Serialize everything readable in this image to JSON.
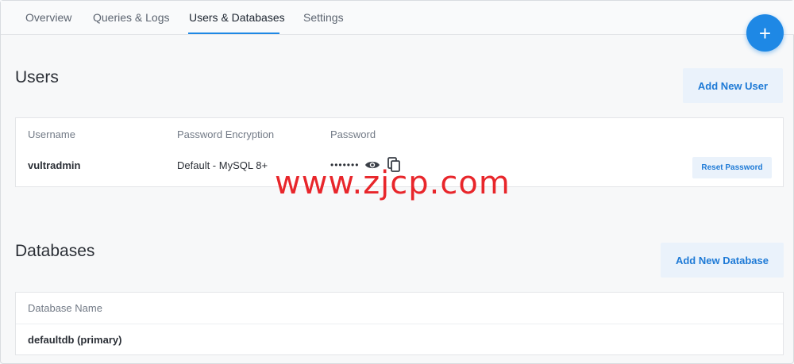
{
  "tabs": [
    {
      "label": "Overview"
    },
    {
      "label": "Queries & Logs"
    },
    {
      "label": "Users & Databases"
    },
    {
      "label": "Settings"
    }
  ],
  "active_tab": "Users & Databases",
  "fab": {
    "label": "+",
    "icon": "plus-icon"
  },
  "users": {
    "title": "Users",
    "add_button": "Add New User",
    "columns": [
      "Username",
      "Password Encryption",
      "Password"
    ],
    "rows": [
      {
        "username": "vultradmin",
        "encryption": "Default - MySQL 8+",
        "password": "•••••••",
        "reset_label": "Reset Password"
      }
    ]
  },
  "databases": {
    "title": "Databases",
    "add_button": "Add New Database",
    "columns": [
      "Database Name"
    ],
    "rows": [
      {
        "name": "defaultdb (primary)"
      }
    ]
  },
  "watermark": "www.zjcp.com",
  "colors": {
    "accent": "#1e88e5",
    "button_bg": "#eaf2fb",
    "watermark": "#e8262b"
  }
}
